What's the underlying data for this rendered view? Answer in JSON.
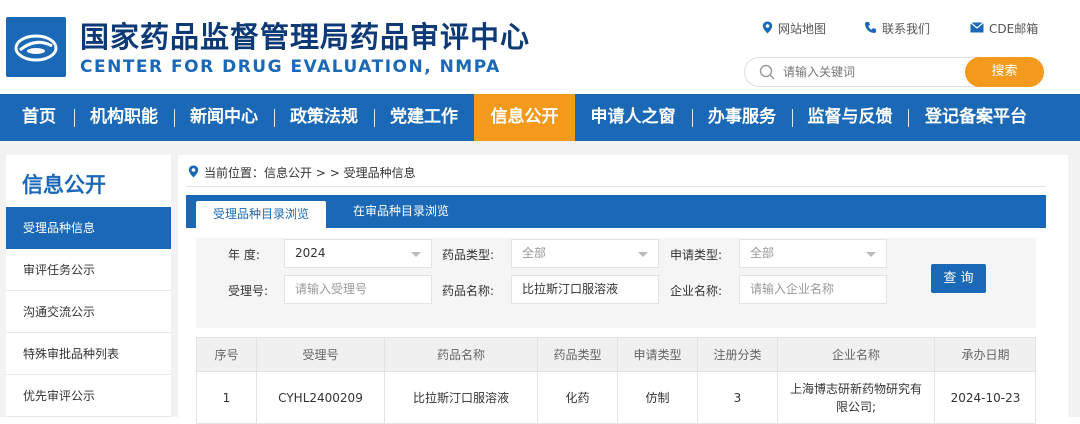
{
  "header": {
    "title_cn": "国家药品监督管理局药品审评中心",
    "title_en": "CENTER FOR DRUG EVALUATION, NMPA",
    "top_links": [
      {
        "label": "网站地图",
        "icon": "location-pin-icon"
      },
      {
        "label": "联系我们",
        "icon": "phone-icon"
      },
      {
        "label": "CDE邮箱",
        "icon": "mail-icon"
      }
    ],
    "search": {
      "placeholder": "请输入关键词",
      "button_label": "搜索"
    }
  },
  "nav": {
    "items": [
      "首页",
      "机构职能",
      "新闻中心",
      "政策法规",
      "党建工作",
      "信息公开",
      "申请人之窗",
      "办事服务",
      "监督与反馈",
      "登记备案平台"
    ],
    "active": "信息公开"
  },
  "sidebar": {
    "title": "信息公开",
    "items": [
      "受理品种信息",
      "审评任务公示",
      "沟通交流公示",
      "特殊审批品种列表",
      "优先审评公示"
    ]
  },
  "breadcrumb": {
    "prefix": "当前位置：",
    "text": "信息公开 > > 受理品种信息"
  },
  "tabs": [
    "受理品种目录浏览",
    "在审品种目录浏览"
  ],
  "filters": {
    "year_label": "年    度:",
    "year_value": "2024",
    "drug_type_label": "药品类型:",
    "drug_type_value": "全部",
    "apply_type_label": "申请类型:",
    "apply_type_value": "全部",
    "accept_no_label": "受理号:",
    "accept_no_placeholder": "请输入受理号",
    "drug_name_label": "药品名称:",
    "drug_name_value": "比拉斯汀口服溶液",
    "company_label": "企业名称:",
    "company_placeholder": "请输入企业名称",
    "query_label": "查 询"
  },
  "table": {
    "headers": [
      "序号",
      "受理号",
      "药品名称",
      "药品类型",
      "申请类型",
      "注册分类",
      "企业名称",
      "承办日期"
    ],
    "rows": [
      [
        "1",
        "CYHL2400209",
        "比拉斯汀口服溶液",
        "化药",
        "仿制",
        "3",
        "上海博志研新药物研究有限公司;",
        "2024-10-23"
      ]
    ]
  },
  "colors": {
    "brand_blue": "#1a68b6",
    "accent_orange": "#f39a1d",
    "title_navy": "#0d3a77"
  }
}
